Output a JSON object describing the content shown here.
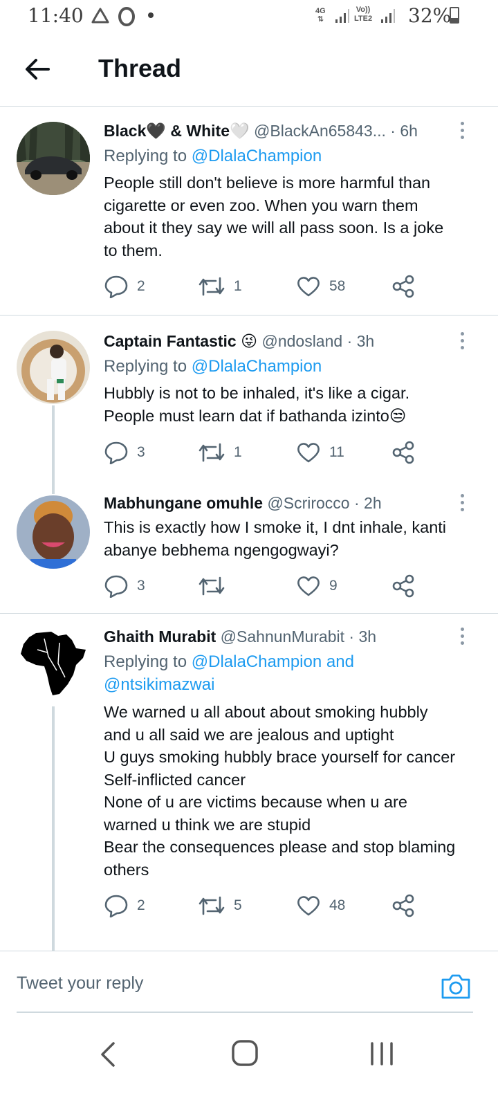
{
  "status_bar": {
    "time": "11:40",
    "network": "4G",
    "volte": "Vo))",
    "volte_sub": "LTE2",
    "battery": "32%",
    "battery_level": 0.32,
    "icons": [
      "recycle-icon",
      "opera-icon",
      "notification-dot-icon",
      "signal-icon",
      "signal-icon",
      "battery-icon"
    ]
  },
  "header": {
    "title": "Thread",
    "back_icon": "arrow-left-icon"
  },
  "tweets": [
    {
      "name": "Black🖤 & White🤍",
      "handle": "@BlackAn65843...",
      "time": "· 6h",
      "replying_prefix": "Replying to",
      "replying_to": "@DlalaChampion",
      "replying_to_2": "",
      "text_lines": [
        "People still don't believe is more harmful than",
        "cigarette or even zoo. When you warn them",
        "about it they say we will all pass soon. Is a joke",
        "to them."
      ],
      "replies": "2",
      "retweets": "1",
      "likes": "58"
    },
    {
      "name": "Captain Fantastic 😜",
      "handle": "@ndosland",
      "time": "· 3h",
      "replying_prefix": "Replying to",
      "replying_to": "@DlalaChampion",
      "replying_to_2": "",
      "text_lines": [
        "Hubbly is not to be inhaled, it's like a cigar.",
        "People must learn dat if bathanda izinto😒"
      ],
      "replies": "3",
      "retweets": "1",
      "likes": "11"
    },
    {
      "name": "Mabhungane omuhle",
      "handle": "@Scrirocco",
      "time": "· 2h",
      "replying_prefix": "",
      "replying_to": "",
      "replying_to_2": "",
      "text_lines": [
        "This is exactly how I smoke it, I dnt inhale, kanti",
        "abanye bebhema ngengogwayi?"
      ],
      "replies": "3",
      "retweets": "",
      "likes": "9"
    },
    {
      "name": "Ghaith Murabit",
      "handle": "@SahnunMurabit",
      "time": "· 3h",
      "replying_prefix": "Replying to",
      "replying_to": "@DlalaChampion and",
      "replying_to_2": "@ntsikimazwai",
      "text_lines": [
        "We warned u all about about smoking hubbly",
        "and u all said we are jealous and uptight",
        "U guys smoking hubbly brace yourself for cancer",
        "Self-inflicted cancer",
        "None of u are victims because when u are",
        "warned u think we are stupid",
        "Bear the consequences please and stop blaming",
        "others"
      ],
      "replies": "2",
      "retweets": "5",
      "likes": "48"
    }
  ],
  "composer": {
    "placeholder": "Tweet your reply",
    "camera_icon": "camera-icon"
  },
  "nav_bar": {
    "icons": [
      "nav-back-icon",
      "nav-home-icon",
      "nav-recents-icon"
    ]
  },
  "colors": {
    "link": "#1d9bf0",
    "text": "#0f1419",
    "secondary": "#536471",
    "divider": "#cfd9de"
  }
}
